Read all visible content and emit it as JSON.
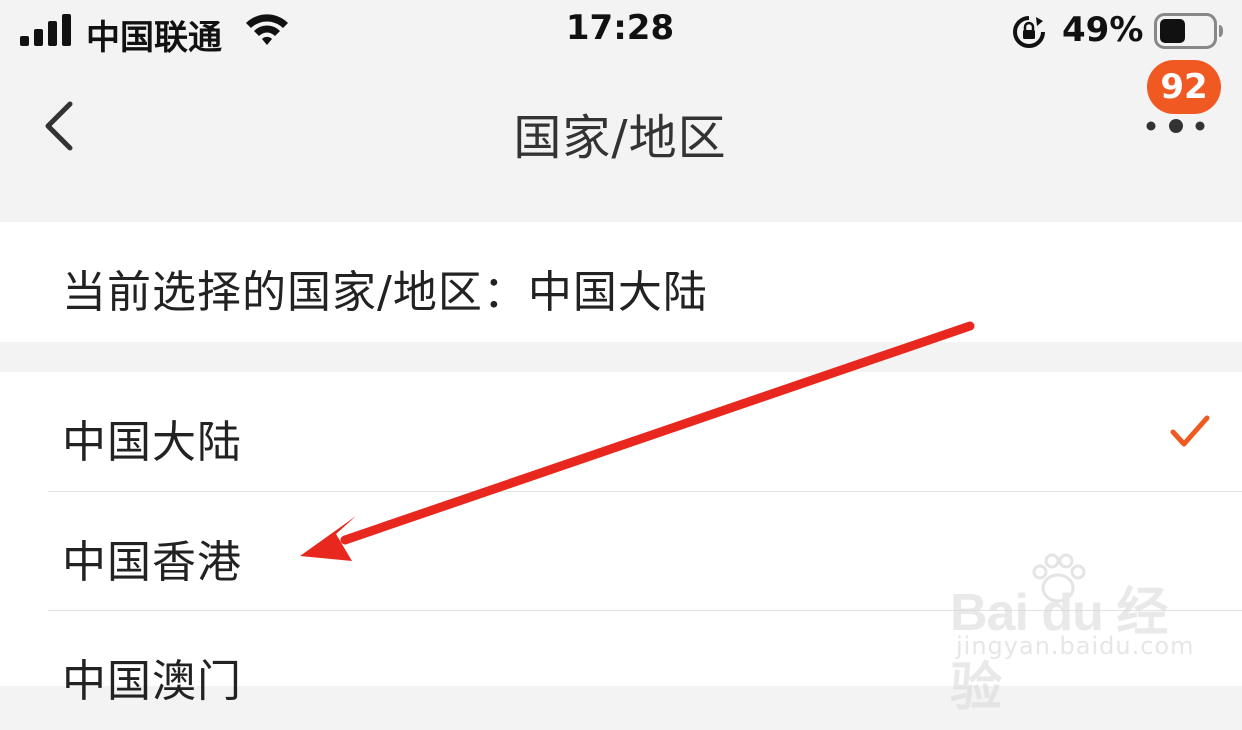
{
  "status_bar": {
    "carrier": "中国联通",
    "time": "17:28",
    "battery_percent_label": "49%",
    "battery_level": 0.49
  },
  "nav": {
    "title": "国家/地区",
    "back_icon": "chevron-left-icon",
    "more_icon": "more-dots-icon",
    "badge_count": "92"
  },
  "current": {
    "label": "当前选择的国家/地区：中国大陆"
  },
  "regions": [
    {
      "label": "中国大陆",
      "selected": true
    },
    {
      "label": "中国香港",
      "selected": false
    },
    {
      "label": "中国澳门",
      "selected": false
    }
  ],
  "watermark": {
    "url": "jingyan.baidu.com"
  },
  "colors": {
    "accent": "#f05a22",
    "annotation_arrow": "#e8281e",
    "background": "#f4f3f4"
  }
}
